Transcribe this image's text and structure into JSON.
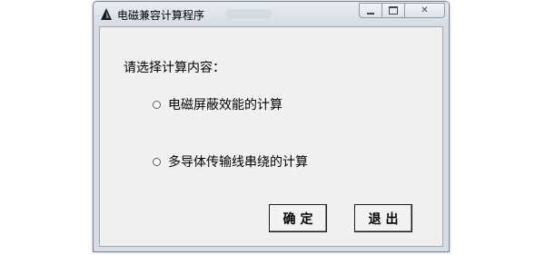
{
  "window": {
    "title": "电磁兼容计算程序",
    "icon": "triangle-app-icon",
    "caption": {
      "minimize_glyph": "minimize-icon",
      "maximize_glyph": "maximize-icon",
      "close_glyph": "✕"
    }
  },
  "form": {
    "prompt": "请选择计算内容：",
    "options": [
      {
        "label": "电磁屏蔽效能的计算",
        "selected": false
      },
      {
        "label": "多导体传输线串绕的计算",
        "selected": false
      }
    ]
  },
  "buttons": {
    "confirm": "确定",
    "exit": "退出"
  }
}
